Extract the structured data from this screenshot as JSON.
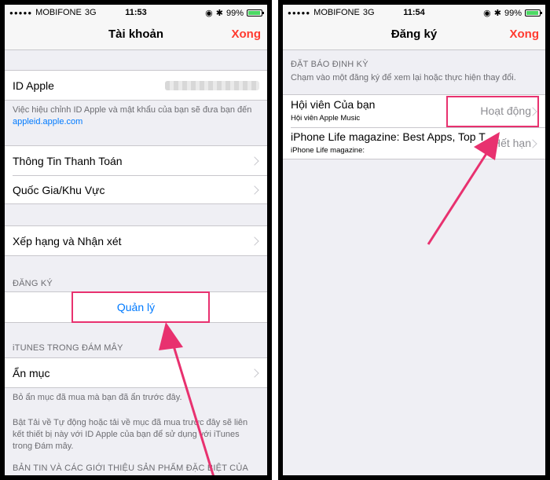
{
  "left_phone": {
    "status": {
      "carrier": "MOBIFONE",
      "network": "3G",
      "time": "11:53",
      "battery": "99%"
    },
    "nav": {
      "title": "Tài khoản",
      "action": "Xong"
    },
    "apple_id_label": "ID Apple",
    "apple_id_footer_prefix": "Việc hiệu chỉnh ID Apple và mật khẩu của bạn sẽ đưa bạn đến ",
    "apple_id_footer_link": "appleid.apple.com",
    "payment": "Thông Tin Thanh Toán",
    "country": "Quốc Gia/Khu Vực",
    "ratings": "Xếp hạng và Nhận xét",
    "subscriptions_header": "ĐĂNG KÝ",
    "manage": "Quản lý",
    "itunes_header": "iTUNES TRONG ĐÁM MÂY",
    "hidden": "Ẩn mục",
    "hidden_footer": "Bỏ ẩn mục đã mua mà bạn đã ẩn trước đây.",
    "auto_footer": "Bật Tải về Tự động hoặc tải về mục đã mua trước đây sẽ liên kết thiết bị này với ID Apple của bạn để sử dụng với iTunes trong Đám mây.",
    "newsletter_header": "BẢN TIN VÀ CÁC GIỚI THIỆU SẢN PHẨM ĐẶC BIỆT CỦA"
  },
  "right_phone": {
    "status": {
      "carrier": "MOBIFONE",
      "network": "3G",
      "time": "11:54",
      "battery": "99%"
    },
    "nav": {
      "title": "Đăng ký",
      "action": "Xong"
    },
    "section_header": "ĐẶT BÁO ĐỊNH KỲ",
    "section_desc": "Chạm vào một đăng ký để xem lại hoặc thực hiện thay đổi.",
    "items": [
      {
        "title": "Hội viên Của bạn",
        "subtitle": "Hội viên Apple Music",
        "status": "Hoạt động"
      },
      {
        "title": "iPhone Life magazine: Best Apps, Top T",
        "subtitle": "iPhone Life magazine:",
        "status": "Hết hạn"
      }
    ]
  },
  "colors": {
    "highlight": "#e8316f",
    "link": "#007aff",
    "done": "#ff3b30"
  }
}
